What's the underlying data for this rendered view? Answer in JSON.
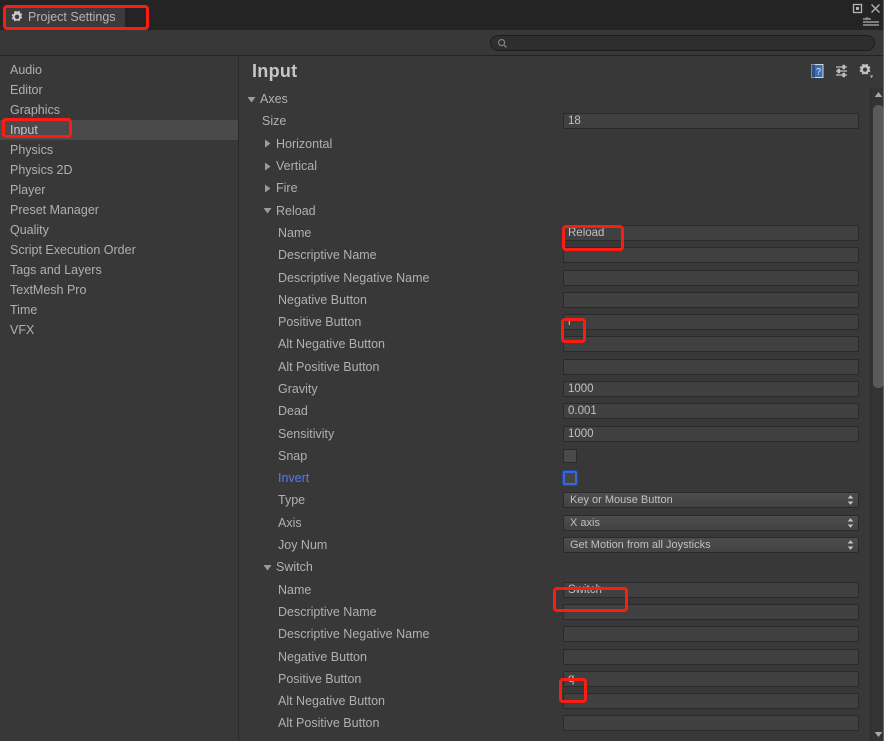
{
  "window": {
    "tab_label": "Project Settings",
    "tab_icon": "gear-icon",
    "maximize_icon": "maximize-icon",
    "close_icon": "close-icon",
    "menu_icon": "window-menu-icon"
  },
  "search": {
    "placeholder": "",
    "value": "",
    "icon": "search-icon"
  },
  "sidebar": {
    "items": [
      {
        "label": "Audio",
        "selected": false
      },
      {
        "label": "Editor",
        "selected": false
      },
      {
        "label": "Graphics",
        "selected": false
      },
      {
        "label": "Input",
        "selected": true
      },
      {
        "label": "Physics",
        "selected": false
      },
      {
        "label": "Physics 2D",
        "selected": false
      },
      {
        "label": "Player",
        "selected": false
      },
      {
        "label": "Preset Manager",
        "selected": false
      },
      {
        "label": "Quality",
        "selected": false
      },
      {
        "label": "Script Execution Order",
        "selected": false
      },
      {
        "label": "Tags and Layers",
        "selected": false
      },
      {
        "label": "TextMesh Pro",
        "selected": false
      },
      {
        "label": "Time",
        "selected": false
      },
      {
        "label": "VFX",
        "selected": false
      }
    ]
  },
  "main": {
    "title": "Input",
    "header_icons": [
      {
        "name": "help-icon"
      },
      {
        "name": "preset-icon"
      },
      {
        "name": "settings-gear-icon"
      }
    ],
    "rows": [
      {
        "label": "Axes",
        "indent": 0,
        "twisty": "open",
        "control": "none"
      },
      {
        "label": "Size",
        "indent": 1,
        "twisty": "none",
        "control": "text",
        "value": "18"
      },
      {
        "label": "Horizontal",
        "indent": 1,
        "twisty": "closed",
        "control": "none"
      },
      {
        "label": "Vertical",
        "indent": 1,
        "twisty": "closed",
        "control": "none"
      },
      {
        "label": "Fire",
        "indent": 1,
        "twisty": "closed",
        "control": "none"
      },
      {
        "label": "Reload",
        "indent": 1,
        "twisty": "open",
        "control": "none"
      },
      {
        "label": "Name",
        "indent": 2,
        "twisty": "none",
        "control": "text",
        "value": "Reload"
      },
      {
        "label": "Descriptive Name",
        "indent": 2,
        "twisty": "none",
        "control": "text",
        "value": ""
      },
      {
        "label": "Descriptive Negative Name",
        "indent": 2,
        "twisty": "none",
        "control": "text",
        "value": ""
      },
      {
        "label": "Negative Button",
        "indent": 2,
        "twisty": "none",
        "control": "text",
        "value": ""
      },
      {
        "label": "Positive Button",
        "indent": 2,
        "twisty": "none",
        "control": "text",
        "value": "r"
      },
      {
        "label": "Alt Negative Button",
        "indent": 2,
        "twisty": "none",
        "control": "text",
        "value": ""
      },
      {
        "label": "Alt Positive Button",
        "indent": 2,
        "twisty": "none",
        "control": "text",
        "value": ""
      },
      {
        "label": "Gravity",
        "indent": 2,
        "twisty": "none",
        "control": "text",
        "value": "1000"
      },
      {
        "label": "Dead",
        "indent": 2,
        "twisty": "none",
        "control": "text",
        "value": "0.001"
      },
      {
        "label": "Sensitivity",
        "indent": 2,
        "twisty": "none",
        "control": "text",
        "value": "1000"
      },
      {
        "label": "Snap",
        "indent": 2,
        "twisty": "none",
        "control": "checkbox",
        "checked": false,
        "focused": false
      },
      {
        "label": "Invert",
        "indent": 2,
        "twisty": "none",
        "control": "checkbox",
        "checked": false,
        "focused": true,
        "accent": true
      },
      {
        "label": "Type",
        "indent": 2,
        "twisty": "none",
        "control": "dropdown",
        "value": "Key or Mouse Button"
      },
      {
        "label": "Axis",
        "indent": 2,
        "twisty": "none",
        "control": "dropdown",
        "value": "X axis"
      },
      {
        "label": "Joy Num",
        "indent": 2,
        "twisty": "none",
        "control": "dropdown",
        "value": "Get Motion from all Joysticks"
      },
      {
        "label": "Switch",
        "indent": 1,
        "twisty": "open",
        "control": "none"
      },
      {
        "label": "Name",
        "indent": 2,
        "twisty": "none",
        "control": "text",
        "value": "Switch"
      },
      {
        "label": "Descriptive Name",
        "indent": 2,
        "twisty": "none",
        "control": "text",
        "value": ""
      },
      {
        "label": "Descriptive Negative Name",
        "indent": 2,
        "twisty": "none",
        "control": "text",
        "value": ""
      },
      {
        "label": "Negative Button",
        "indent": 2,
        "twisty": "none",
        "control": "text",
        "value": ""
      },
      {
        "label": "Positive Button",
        "indent": 2,
        "twisty": "none",
        "control": "text",
        "value": "q"
      },
      {
        "label": "Alt Negative Button",
        "indent": 2,
        "twisty": "none",
        "control": "text",
        "value": ""
      },
      {
        "label": "Alt Positive Button",
        "indent": 2,
        "twisty": "none",
        "control": "text",
        "value": ""
      }
    ]
  },
  "colors": {
    "background": "#383838",
    "panel": "#3b3b3b",
    "field": "#404040",
    "text": "#b0b0b0",
    "accent": "#4d7dfb",
    "annotation": "#fb1d13",
    "selection": "#4a4a4a"
  },
  "annotations": [
    {
      "target": "tab-project-settings"
    },
    {
      "target": "sidebar-item-input"
    },
    {
      "target": "reload-name-value"
    },
    {
      "target": "reload-positive-button-value"
    },
    {
      "target": "switch-name-value"
    },
    {
      "target": "switch-positive-button-value"
    }
  ]
}
